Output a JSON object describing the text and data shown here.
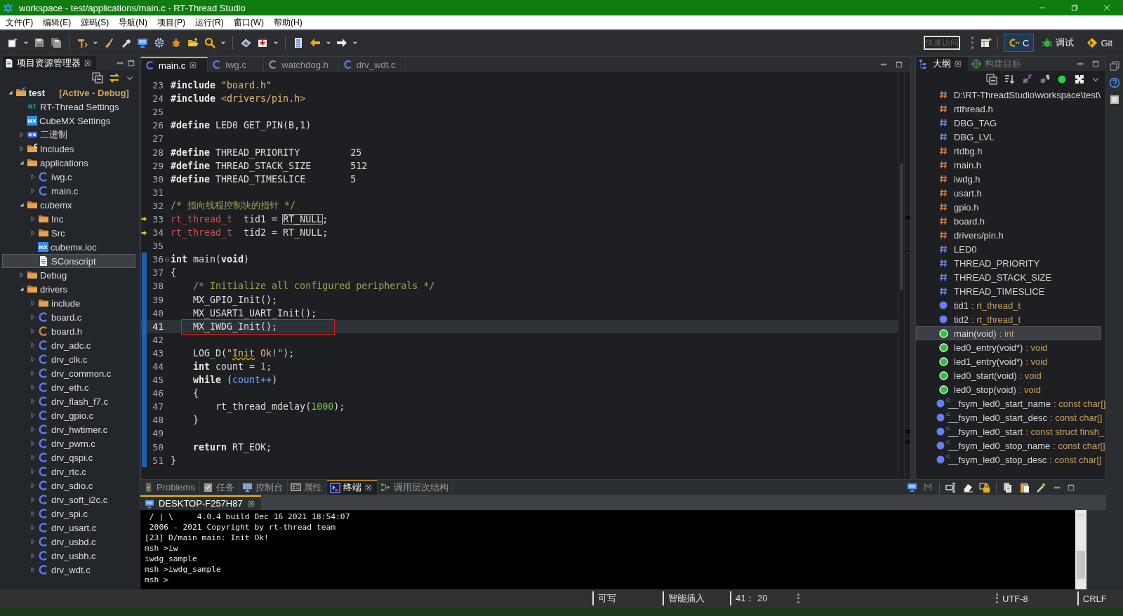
{
  "window": {
    "title": "workspace - test/applications/main.c - RT-Thread Studio"
  },
  "menu": [
    "文件(F)",
    "编辑(E)",
    "源码(S)",
    "导航(N)",
    "项目(P)",
    "运行(R)",
    "窗口(W)",
    "帮助(H)"
  ],
  "toolbar_right": {
    "quick_access": {
      "placeholder": "快速访问"
    },
    "perspectives": [
      {
        "label": "C",
        "kind": "cpp",
        "selected": true
      },
      {
        "label": "调试",
        "kind": "debug",
        "selected": false
      },
      {
        "label": "Git",
        "kind": "git",
        "selected": false
      }
    ]
  },
  "project_explorer": {
    "title": "项目资源管理器",
    "tree": [
      {
        "label": "test",
        "tag": "[Active - Debug]",
        "kind": "project",
        "expanded": true,
        "selected": false,
        "children": [
          {
            "label": "RT-Thread Settings",
            "kind": "rt",
            "badge": "RT",
            "selected": false
          },
          {
            "label": "CubeMX Settings",
            "kind": "mx",
            "badge": "MX",
            "selected": false
          },
          {
            "label": "二进制",
            "kind": "binary",
            "expanded": false,
            "selected": false
          },
          {
            "label": "Includes",
            "kind": "includes",
            "expanded": false,
            "selected": false
          },
          {
            "label": "applications",
            "kind": "folder",
            "expanded": true,
            "selected": false,
            "children": [
              {
                "label": "iwg.c",
                "kind": "c",
                "expanded": false,
                "selected": false
              },
              {
                "label": "main.c",
                "kind": "c",
                "expanded": false,
                "selected": false
              }
            ]
          },
          {
            "label": "cubemx",
            "kind": "folder",
            "expanded": true,
            "selected": false,
            "children": [
              {
                "label": "Inc",
                "kind": "folder",
                "expanded": false,
                "selected": false
              },
              {
                "label": "Src",
                "kind": "folder",
                "expanded": false,
                "selected": false
              },
              {
                "label": "cubemx.ioc",
                "kind": "mx",
                "badge": "MX",
                "selected": false
              },
              {
                "label": "SConscript",
                "kind": "file",
                "selected": true
              }
            ]
          },
          {
            "label": "Debug",
            "kind": "folder",
            "expanded": false,
            "selected": false
          },
          {
            "label": "drivers",
            "kind": "folder",
            "expanded": true,
            "selected": false,
            "children": [
              {
                "label": "include",
                "kind": "folder",
                "expanded": false,
                "selected": false
              },
              {
                "label": "board.c",
                "kind": "c",
                "expanded": false,
                "selected": false
              },
              {
                "label": "board.h",
                "kind": "h",
                "expanded": false,
                "selected": false
              },
              {
                "label": "drv_adc.c",
                "kind": "c",
                "expanded": false,
                "selected": false
              },
              {
                "label": "drv_clk.c",
                "kind": "c",
                "expanded": false,
                "selected": false
              },
              {
                "label": "drv_common.c",
                "kind": "c",
                "expanded": false,
                "selected": false
              },
              {
                "label": "drv_eth.c",
                "kind": "c",
                "expanded": false,
                "selected": false
              },
              {
                "label": "drv_flash_f7.c",
                "kind": "c",
                "expanded": false,
                "selected": false
              },
              {
                "label": "drv_gpio.c",
                "kind": "c",
                "expanded": false,
                "selected": false
              },
              {
                "label": "drv_hwtimer.c",
                "kind": "c",
                "expanded": false,
                "selected": false
              },
              {
                "label": "drv_pwm.c",
                "kind": "c",
                "expanded": false,
                "selected": false
              },
              {
                "label": "drv_qspi.c",
                "kind": "c",
                "expanded": false,
                "selected": false
              },
              {
                "label": "drv_rtc.c",
                "kind": "c",
                "expanded": false,
                "selected": false
              },
              {
                "label": "drv_sdio.c",
                "kind": "c",
                "expanded": false,
                "selected": false
              },
              {
                "label": "drv_soft_i2c.c",
                "kind": "c",
                "expanded": false,
                "selected": false
              },
              {
                "label": "drv_spi.c",
                "kind": "c",
                "expanded": false,
                "selected": false
              },
              {
                "label": "drv_usart.c",
                "kind": "c",
                "expanded": false,
                "selected": false
              },
              {
                "label": "drv_usbd.c",
                "kind": "c",
                "expanded": false,
                "selected": false
              },
              {
                "label": "drv_usbh.c",
                "kind": "c",
                "expanded": false,
                "selected": false
              },
              {
                "label": "drv_wdt.c",
                "kind": "c",
                "expanded": false,
                "selected": false
              }
            ]
          }
        ]
      }
    ]
  },
  "editor": {
    "tabs": [
      {
        "label": "main.c",
        "kind": "c",
        "selected": true
      },
      {
        "label": "iwg.c",
        "kind": "c",
        "selected": false
      },
      {
        "label": "watchdog.h",
        "kind": "h",
        "selected": false
      },
      {
        "label": "drv_wdt.c",
        "kind": "c",
        "selected": false
      }
    ],
    "lines": [
      {
        "number": "23",
        "marked": false,
        "changed": false,
        "current": false,
        "tokens": [
          {
            "text": "#include ",
            "kind": "keyword"
          },
          {
            "text": "\"board.h\"",
            "kind": "string"
          }
        ]
      },
      {
        "number": "24",
        "marked": false,
        "changed": false,
        "current": false,
        "tokens": [
          {
            "text": "#include ",
            "kind": "keyword"
          },
          {
            "text": "<drivers/pin.h>",
            "kind": "string"
          }
        ]
      },
      {
        "number": "25",
        "marked": false,
        "changed": false,
        "current": false
      },
      {
        "number": "26",
        "marked": false,
        "changed": false,
        "current": false,
        "tokens": [
          {
            "text": "#define",
            "kind": "keyword"
          },
          {
            "text": " LED0 GET_PIN(B,1)"
          }
        ]
      },
      {
        "number": "27",
        "marked": false,
        "changed": false,
        "current": false
      },
      {
        "number": "28",
        "marked": false,
        "changed": false,
        "current": false,
        "tokens": [
          {
            "text": "#define",
            "kind": "keyword"
          },
          {
            "text": " THREAD_PRIORITY         25"
          }
        ]
      },
      {
        "number": "29",
        "marked": false,
        "changed": false,
        "current": false,
        "tokens": [
          {
            "text": "#define",
            "kind": "keyword"
          },
          {
            "text": " THREAD_STACK_SIZE       512"
          }
        ]
      },
      {
        "number": "30",
        "marked": false,
        "changed": false,
        "current": false,
        "tokens": [
          {
            "text": "#define",
            "kind": "keyword"
          },
          {
            "text": " THREAD_TIMESLICE        5"
          }
        ]
      },
      {
        "number": "31",
        "marked": false,
        "changed": false,
        "current": false
      },
      {
        "number": "32",
        "marked": false,
        "changed": false,
        "current": false,
        "tokens": [
          {
            "text": "/* 指向线程控制块的指针 */",
            "kind": "comment"
          }
        ]
      },
      {
        "number": "33",
        "marked": true,
        "changed": false,
        "current": false,
        "tokens": [
          {
            "text": "rt_thread_t",
            "kind": "type"
          },
          {
            "text": "  tid1 = "
          },
          {
            "text": "RT_NULL",
            "occurrence": true
          },
          {
            "text": ";"
          }
        ]
      },
      {
        "number": "34",
        "marked": true,
        "changed": false,
        "current": false,
        "tokens": [
          {
            "text": "rt_thread_t",
            "kind": "type"
          },
          {
            "text": "  tid2 = RT_NULL;"
          }
        ]
      },
      {
        "number": "35",
        "marked": false,
        "changed": false,
        "current": false
      },
      {
        "number": "36",
        "marked": false,
        "changed": true,
        "current": false,
        "folded": false,
        "tokens": [
          {
            "text": "int",
            "kind": "keyword"
          },
          {
            "text": " main("
          },
          {
            "text": "void",
            "kind": "keyword"
          },
          {
            "text": ")"
          }
        ]
      },
      {
        "number": "37",
        "marked": false,
        "changed": true,
        "current": false,
        "tokens": [
          {
            "text": "{"
          }
        ]
      },
      {
        "number": "38",
        "marked": false,
        "changed": true,
        "current": false,
        "tokens": [
          {
            "text": "    /* Initialize all configured peripherals */",
            "kind": "comment"
          }
        ]
      },
      {
        "number": "39",
        "marked": false,
        "changed": true,
        "current": false,
        "tokens": [
          {
            "text": "    MX_GPIO_Init();"
          }
        ]
      },
      {
        "number": "40",
        "marked": false,
        "changed": true,
        "current": false,
        "tokens": [
          {
            "text": "    MX_USART1_UART_Init();"
          }
        ]
      },
      {
        "number": "41",
        "marked": false,
        "changed": true,
        "current": true,
        "tokens": [
          {
            "text": "    MX_IWDG_Init();",
            "annotated": true
          }
        ]
      },
      {
        "number": "42",
        "marked": false,
        "changed": true,
        "current": false
      },
      {
        "number": "43",
        "marked": false,
        "changed": true,
        "current": false,
        "tokens": [
          {
            "text": "    LOG_D("
          },
          {
            "text": "\"",
            "kind": "string"
          },
          {
            "text": "Init",
            "kind": "string",
            "squiggle": true
          },
          {
            "text": " Ok!\"",
            "kind": "string"
          },
          {
            "text": ");"
          }
        ]
      },
      {
        "number": "44",
        "marked": false,
        "changed": true,
        "current": false,
        "tokens": [
          {
            "text": "    int",
            "kind": "keyword"
          },
          {
            "text": " count = "
          },
          {
            "text": "1",
            "kind": "number"
          },
          {
            "text": ";"
          }
        ]
      },
      {
        "number": "45",
        "marked": false,
        "changed": true,
        "current": false,
        "tokens": [
          {
            "text": "    while",
            "kind": "keyword"
          },
          {
            "text": " ("
          },
          {
            "text": "count++",
            "kind": "variable"
          },
          {
            "text": ")"
          }
        ]
      },
      {
        "number": "46",
        "marked": false,
        "changed": true,
        "current": false,
        "tokens": [
          {
            "text": "    {"
          }
        ]
      },
      {
        "number": "47",
        "marked": false,
        "changed": true,
        "current": false,
        "tokens": [
          {
            "text": "        rt_thread_mdelay("
          },
          {
            "text": "1000",
            "kind": "number"
          },
          {
            "text": ");"
          }
        ]
      },
      {
        "number": "48",
        "marked": false,
        "changed": true,
        "current": false,
        "tokens": [
          {
            "text": "    }"
          }
        ]
      },
      {
        "number": "49",
        "marked": false,
        "changed": true,
        "current": false
      },
      {
        "number": "50",
        "marked": false,
        "changed": true,
        "current": false,
        "tokens": [
          {
            "text": "    return",
            "kind": "keyword"
          },
          {
            "text": " RT_EOK;"
          }
        ]
      },
      {
        "number": "51",
        "marked": false,
        "changed": true,
        "current": false,
        "tokens": [
          {
            "text": "}"
          }
        ]
      }
    ]
  },
  "outline": {
    "tabs": [
      {
        "label": "大纲",
        "kind": "outline",
        "selected": true
      },
      {
        "label": "构建目标",
        "kind": "target",
        "selected": false
      }
    ],
    "items": [
      {
        "label": "D:\\RT-ThreadStudio\\workspace\\test\\",
        "kind": "include",
        "selected": false
      },
      {
        "label": "rtthread.h",
        "kind": "include",
        "selected": false
      },
      {
        "label": "DBG_TAG",
        "kind": "macro",
        "selected": false
      },
      {
        "label": "DBG_LVL",
        "kind": "macro",
        "selected": false
      },
      {
        "label": "rtdbg.h",
        "kind": "include",
        "selected": false
      },
      {
        "label": "main.h",
        "kind": "include",
        "selected": false
      },
      {
        "label": "iwdg.h",
        "kind": "include",
        "selected": false
      },
      {
        "label": "usart.h",
        "kind": "include",
        "selected": false
      },
      {
        "label": "gpio.h",
        "kind": "include",
        "selected": false
      },
      {
        "label": "board.h",
        "kind": "include",
        "selected": false
      },
      {
        "label": "drivers/pin.h",
        "kind": "include",
        "selected": false
      },
      {
        "label": "LED0",
        "kind": "macro",
        "selected": false
      },
      {
        "label": "THREAD_PRIORITY",
        "kind": "macro",
        "selected": false
      },
      {
        "label": "THREAD_STACK_SIZE",
        "kind": "macro",
        "selected": false
      },
      {
        "label": "THREAD_TIMESLICE",
        "kind": "macro",
        "selected": false
      },
      {
        "label": "tid1",
        "type": ": rt_thread_t",
        "kind": "variable",
        "selected": false
      },
      {
        "label": "tid2",
        "type": ": rt_thread_t",
        "kind": "variable",
        "selected": false
      },
      {
        "label": "main(void)",
        "type": ": int",
        "kind": "function",
        "selected": true
      },
      {
        "label": "led0_entry(void*)",
        "type": ": void",
        "kind": "function",
        "selected": false
      },
      {
        "label": "led1_entry(void*)",
        "type": ": void",
        "kind": "function",
        "selected": false
      },
      {
        "label": "led0_start(void)",
        "type": ": void",
        "kind": "function",
        "selected": false
      },
      {
        "label": "led0_stop(void)",
        "type": ": void",
        "kind": "function",
        "selected": false
      },
      {
        "label": "__fsym_led0_start_name",
        "type": ": const char[]",
        "kind": "constant",
        "badge": "C",
        "selected": false
      },
      {
        "label": "__fsym_led0_start_desc",
        "type": ": const char[]",
        "kind": "constant",
        "badge": "C",
        "selected": false
      },
      {
        "label": "__fsym_led0_start",
        "type": ": const struct finsh_",
        "kind": "constant",
        "badge": "C",
        "selected": false
      },
      {
        "label": "__fsym_led0_stop_name",
        "type": ": const char[]",
        "kind": "constant",
        "badge": "C",
        "selected": false
      },
      {
        "label": "__fsym_led0_stop_desc",
        "type": ": const char[]",
        "kind": "constant",
        "badge": "C",
        "selected": false
      }
    ]
  },
  "console": {
    "tabs": [
      {
        "label": "Problems",
        "kind": "problems",
        "selected": false
      },
      {
        "label": "任务",
        "kind": "tasks",
        "selected": false
      },
      {
        "label": "控制台",
        "kind": "console",
        "selected": false
      },
      {
        "label": "属性",
        "kind": "properties",
        "selected": false
      },
      {
        "label": "终端",
        "kind": "terminal",
        "selected": true
      },
      {
        "label": "调用层次结构",
        "kind": "hierarchy",
        "selected": false
      }
    ],
    "terminal_tab": "DESKTOP-F257H87",
    "lines": [
      " / | \\     4.0.4 build Dec 16 2021 18:54:07",
      " 2006 - 2021 Copyright by rt-thread team",
      "[23] D/main main: Init Ok!",
      "msh >iw",
      "iwdg_sample",
      "msh >iwdg_sample",
      "msh >"
    ]
  },
  "status_bar": {
    "items": [
      "可写",
      "智能插入",
      "41： 20",
      "UTF-8",
      "CRLF"
    ]
  }
}
